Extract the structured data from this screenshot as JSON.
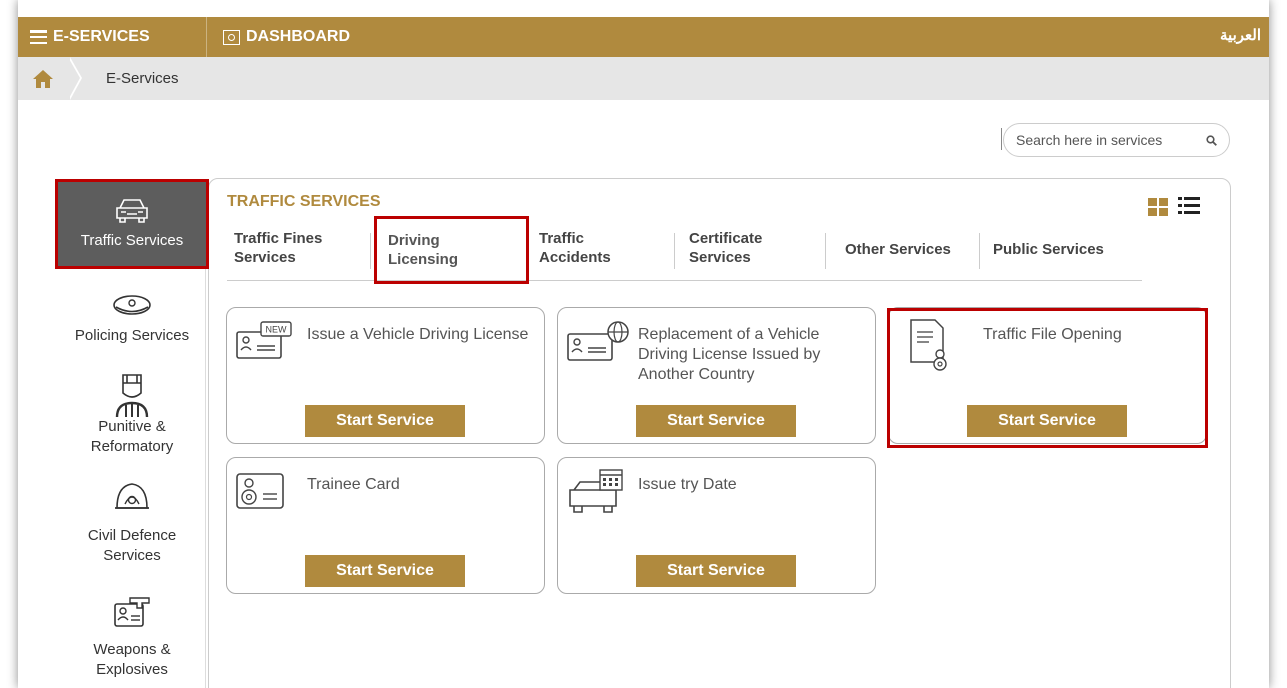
{
  "topbar": {
    "eservices": "E-SERVICES",
    "dashboard": "DASHBOARD",
    "language": "العربية"
  },
  "breadcrumb": {
    "current": "E-Services"
  },
  "search": {
    "placeholder": "Search here in services"
  },
  "sidebar": {
    "items": [
      {
        "label": "Traffic Services",
        "active": true
      },
      {
        "label": "Policing Services"
      },
      {
        "label": "Punitive & Reformatory"
      },
      {
        "label": "Civil Defence Services"
      },
      {
        "label": "Weapons & Explosives"
      }
    ]
  },
  "section": {
    "title": "TRAFFIC SERVICES"
  },
  "tabs": [
    {
      "label": "Traffic Fines Services"
    },
    {
      "label": "Driving Licensing",
      "active": true
    },
    {
      "label": "Traffic Accidents"
    },
    {
      "label": "Certificate Services"
    },
    {
      "label": "Other Services"
    },
    {
      "label": "Public Services"
    }
  ],
  "cards": [
    {
      "title": "Issue a Vehicle Driving License",
      "badge": "NEW",
      "button": "Start Service"
    },
    {
      "title": "Replacement of a Vehicle Driving License Issued by Another Country",
      "button": "Start Service"
    },
    {
      "title": "Traffic File Opening",
      "button": "Start Service"
    },
    {
      "title": "Trainee Card",
      "button": "Start Service"
    },
    {
      "title": "Issue try Date",
      "button": "Start Service"
    }
  ],
  "colors": {
    "brand": "#b08a3e",
    "highlight": "#bb0000",
    "sidebar_active": "#5d5d5d"
  }
}
